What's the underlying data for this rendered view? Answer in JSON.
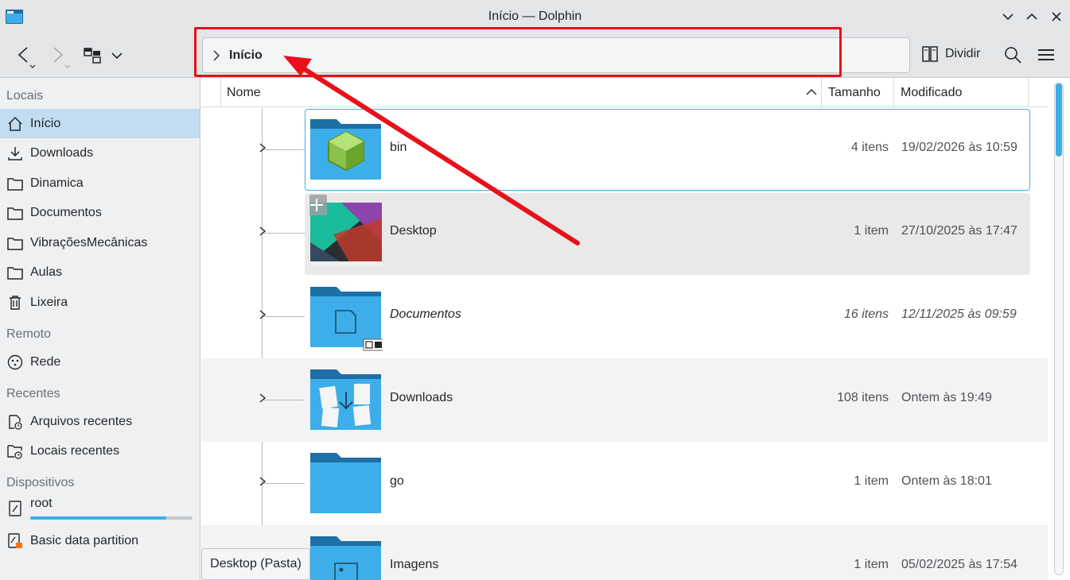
{
  "window": {
    "title": "Início — Dolphin"
  },
  "toolbar": {
    "location_text": "Início",
    "split_label": "Dividir"
  },
  "sidebar": {
    "sections": {
      "places": "Locais",
      "remote": "Remoto",
      "recent": "Recentes",
      "devices": "Dispositivos"
    },
    "places": [
      {
        "label": "Início",
        "icon": "home-icon"
      },
      {
        "label": "Downloads",
        "icon": "download-icon"
      },
      {
        "label": "Dinamica",
        "icon": "folder-icon"
      },
      {
        "label": "Documentos",
        "icon": "folder-icon"
      },
      {
        "label": "VibraçõesMecânicas",
        "icon": "folder-icon"
      },
      {
        "label": "Aulas",
        "icon": "folder-icon"
      },
      {
        "label": "Lixeira",
        "icon": "trash-icon"
      }
    ],
    "remote": [
      {
        "label": "Rede",
        "icon": "network-icon"
      }
    ],
    "recent": [
      {
        "label": "Arquivos recentes",
        "icon": "recent-files-icon"
      },
      {
        "label": "Locais recentes",
        "icon": "recent-places-icon"
      }
    ],
    "devices": [
      {
        "label": "root",
        "icon": "drive-icon",
        "usage": 0.84
      },
      {
        "label": "Basic data partition",
        "icon": "drive-warning-icon"
      }
    ]
  },
  "columns": {
    "name": "Nome",
    "size": "Tamanho",
    "modified": "Modificado"
  },
  "files": [
    {
      "name": "bin",
      "size": "4 itens",
      "modified": "19/02/2026 às 10:59"
    },
    {
      "name": "Desktop",
      "size": "1 item",
      "modified": "27/10/2025 às 17:47"
    },
    {
      "name": "Documentos",
      "size": "16 itens",
      "modified": "12/11/2025 às 09:59"
    },
    {
      "name": "Downloads",
      "size": "108 itens",
      "modified": "Ontem às 19:49"
    },
    {
      "name": "go",
      "size": "1 item",
      "modified": "Ontem às 18:01"
    },
    {
      "name": "Imagens",
      "size": "1 item",
      "modified": "05/02/2025 às 17:54"
    }
  ],
  "tooltip": "Desktop (Pasta)",
  "colors": {
    "accent": "#3daee9",
    "annotation": "#e8101a",
    "folder_blue": "#3daee9",
    "folder_dark": "#1d6fa5"
  }
}
